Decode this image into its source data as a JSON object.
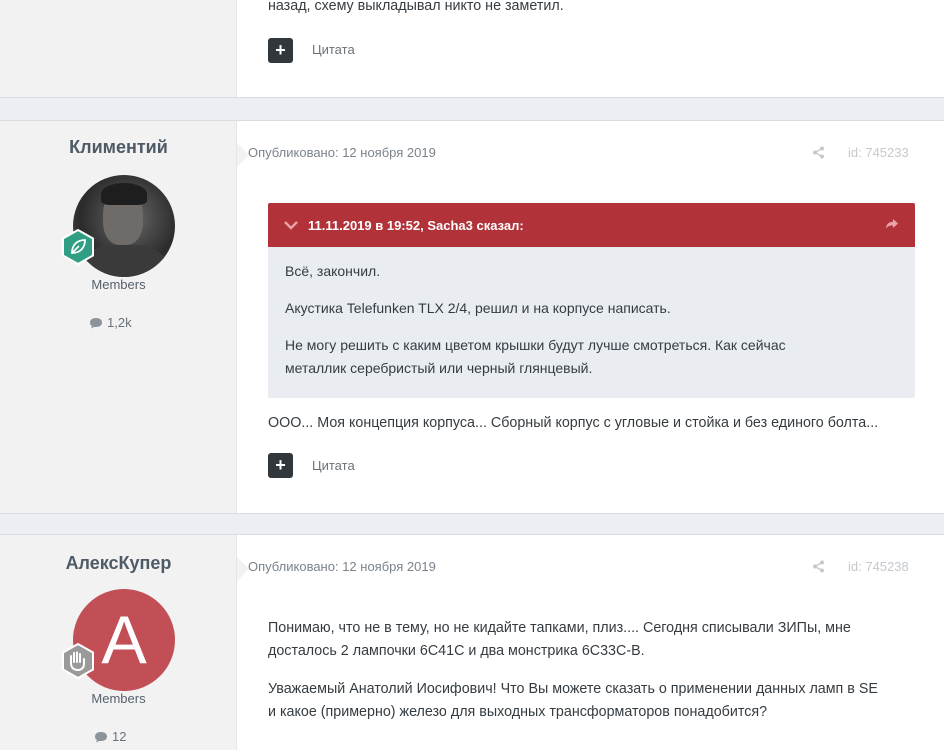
{
  "posts": [
    {
      "tail_text": "назад, схему выкладывал никто не заметил.",
      "quote_action": "Цитата"
    },
    {
      "author": "Климентий",
      "group": "Members",
      "post_count": "1,2k",
      "published": "Опубликовано: 12 ноября 2019",
      "id_label": "id: 745233",
      "quote": {
        "header": "11.11.2019 в 19:52, Sacha3 сказал:",
        "lines": [
          "Всё, закончил.",
          "Акустика Telefunken TLX 2/4, решил и на корпусе написать.",
          "Не могу решить с каким цветом крышки будут лучше смотреться. Как сейчас",
          "металлик серебристый или черный глянцевый."
        ]
      },
      "text": "ООО... Моя концепция корпуса... Сборный корпус с угловые и стойка и без единого болта...",
      "quote_action": "Цитата"
    },
    {
      "author": "АлексКупер",
      "avatar_letter": "A",
      "group": "Members",
      "post_count": "12",
      "published": "Опубликовано: 12 ноября 2019",
      "id_label": "id: 745238",
      "paragraphs": [
        "Понимаю, что не в тему, но не кидайте тапками, плиз.... Сегодня списывали ЗИПы, мне",
        "досталось 2 лампочки 6С41С и два монстрика 6С33С-В.",
        "Уважаемый Анатолий Иосифович! Что Вы можете сказать о применении данных ламп в SE",
        "и какое (примерно) железо для выходных трансформаторов понадобится?"
      ]
    }
  ],
  "icons": {
    "quote_add": "plus-icon",
    "share": "share-icon",
    "comments": "comment-icon",
    "quote_collapse": "chevron-down-icon",
    "quote_link": "forward-arrow-icon",
    "badge_1": "leaf-badge-icon",
    "badge_2": "hand-wave-badge-icon"
  },
  "colors": {
    "quote_header": "#b2323a",
    "badge_green": "#2f9e83",
    "badge_gray": "#9a9a9a",
    "avatar_red": "#c14f55"
  }
}
